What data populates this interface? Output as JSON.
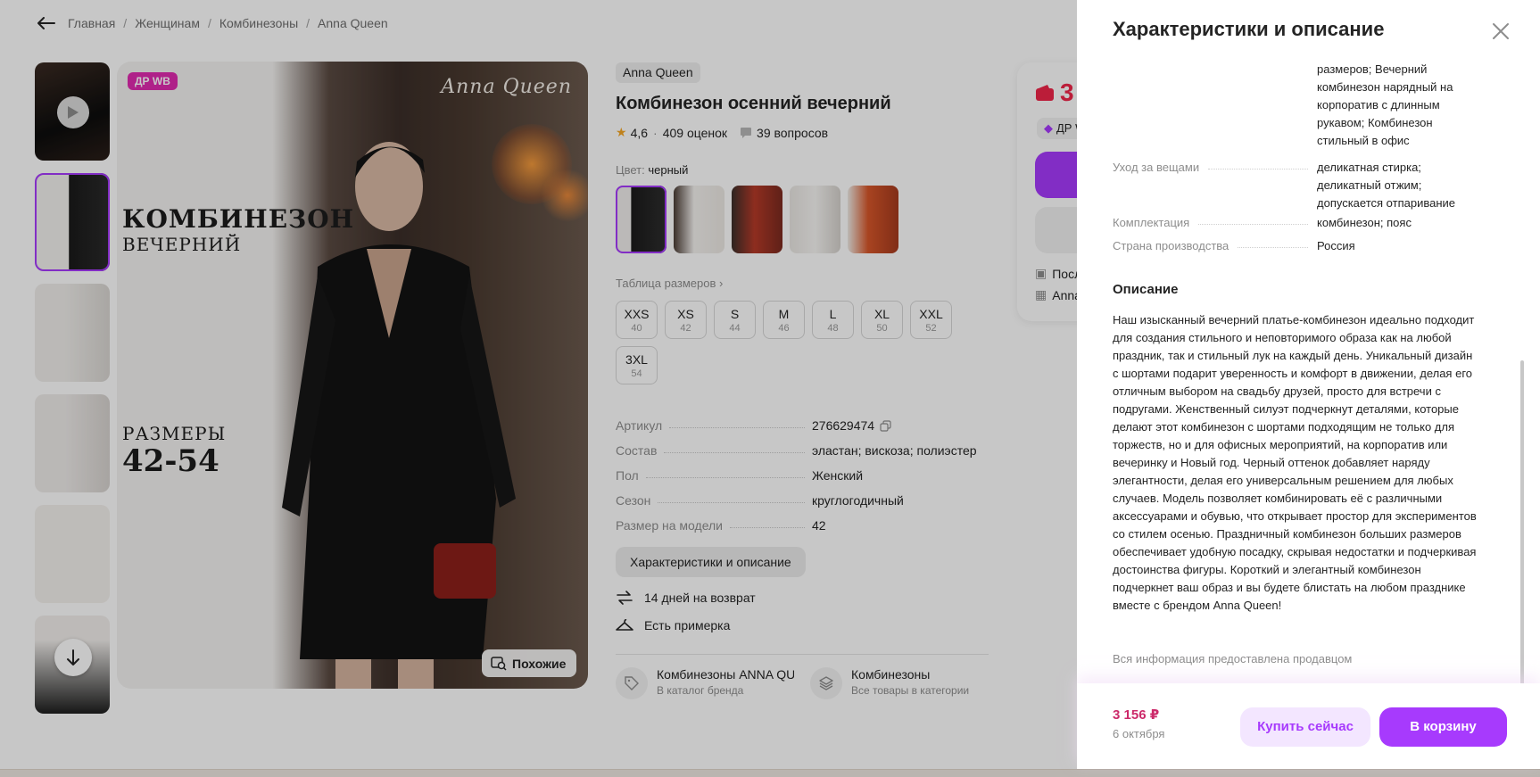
{
  "breadcrumbs": [
    "Главная",
    "Женщинам",
    "Комбинезоны",
    "Anna Queen"
  ],
  "gallery": {
    "badge": "ДР WB",
    "brand_script": "Anna Queen",
    "title_line1": "КОМБИНЕЗОН",
    "title_line2": "ВЕЧЕРНИЙ",
    "sizes_label": "РАЗМЕРЫ",
    "sizes_value": "42-54",
    "similar_label": "Похожие"
  },
  "product": {
    "brand": "Anna Queen",
    "title": "Комбинезон осенний вечерний",
    "rating": "4,6",
    "reviews": "409 оценок",
    "questions": "39 вопросов",
    "color_label": "Цвет:",
    "color_value": "черный",
    "size_table_link": "Таблица размеров",
    "sizes": [
      {
        "label": "XXS",
        "num": "40"
      },
      {
        "label": "XS",
        "num": "42"
      },
      {
        "label": "S",
        "num": "44"
      },
      {
        "label": "M",
        "num": "46"
      },
      {
        "label": "L",
        "num": "48"
      },
      {
        "label": "XL",
        "num": "50"
      },
      {
        "label": "XXL",
        "num": "52"
      },
      {
        "label": "3XL",
        "num": "54"
      }
    ],
    "params": [
      {
        "key": "Артикул",
        "value": "276629474"
      },
      {
        "key": "Состав",
        "value": "эластан; вискоза; полиэстер"
      },
      {
        "key": "Пол",
        "value": "Женский"
      },
      {
        "key": "Сезон",
        "value": "круглогодичный"
      },
      {
        "key": "Размер на модели",
        "value": "42"
      }
    ],
    "char_button": "Характеристики и описание",
    "features": [
      "14 дней на возврат",
      "Есть примерка"
    ],
    "links": [
      {
        "title": "Комбинезоны ANNA QUEEN",
        "sub": "В каталог бренда"
      },
      {
        "title": "Комбинезоны",
        "sub": "Все товары в категории"
      }
    ]
  },
  "price_card": {
    "price_partial": "3",
    "dr_label": "ДР W",
    "row1": "Посл",
    "row2": "Anna"
  },
  "drawer": {
    "title": "Характеристики и описание",
    "top_value": "размеров; Вечерний комбинезон нарядный на корпоратив с длинным рукавом; Комбинезон стильный в офис",
    "specs": [
      {
        "key": "Уход за вещами",
        "value": "деликатная стирка; деликатный отжим; допускается отпаривание"
      },
      {
        "key": "Комплектация",
        "value": "комбинезон; пояс"
      },
      {
        "key": "Страна производства",
        "value": "Россия"
      }
    ],
    "description_title": "Описание",
    "description": "Наш изысканный вечерний платье-комбинезон идеально подходит для создания стильного и неповторимого образа как на любой праздник, так и стильный лук на каждый день. Уникальный дизайн с шортами подарит уверенность и комфорт в движении, делая его отличным выбором на свадьбу друзей, просто для встречи с подругами. Женственный силуэт подчеркнут деталями, которые делают этот комбинезон с шортами подходящим не только для торжеств, но и для офисных мероприятий, на корпоратив или вечеринку и Новый год. Черный оттенок добавляет наряду элегантности, делая его универсальным решением для любых случаев. Модель позволяет комбинировать её с различными аксессуарами и обувью, что открывает простор для экспериментов со стилем осенью. Праздничный комбинезон больших размеров обеспечивает удобную посадку, скрывая недостатки и подчеркивая достоинства фигуры. Короткий и элегантный комбинезон подчеркнет ваш образ и вы будете блистать на любом празднике вместе с брендом Anna Queen!",
    "note": "Вся информация предоставлена продавцом",
    "footer_price": "3 156 ₽",
    "footer_date": "6 октября",
    "buy_now": "Купить сейчас",
    "to_cart": "В корзину"
  },
  "colors": {
    "accent": "#a73afd",
    "price_red": "#f0264a",
    "badge_pink": "#e12bb0"
  }
}
